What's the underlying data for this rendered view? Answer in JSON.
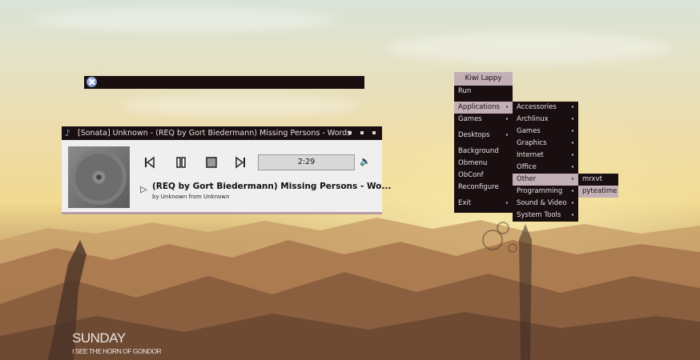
{
  "wallpaper": {
    "line1": "SUNDAY",
    "line2": "I SEE THE HORN OF GONDOR"
  },
  "topbar": {
    "logo_icon": "arch-x-logo-icon"
  },
  "sonata": {
    "window_title": "[Sonata] Unknown - (REQ by Gort Biedermann) Missing Persons - Words",
    "time": "2:29",
    "progress_fraction": 0.42,
    "song_title": "(REQ by Gort Biedermann) Missing Persons - Wo...",
    "byline": "by Unknown from Unknown",
    "icons": {
      "app": "music-note-icon",
      "prev": "skip-previous-icon",
      "pause": "pause-icon",
      "stop": "stop-icon",
      "next": "skip-next-icon",
      "volume": "volume-icon",
      "expander": "expander-triangle-icon"
    }
  },
  "root_menu": {
    "title": "Kiwi Lappy",
    "items": [
      {
        "label": "Run",
        "sub": false
      },
      {
        "label": "Applications",
        "sub": true,
        "active": true
      },
      {
        "label": "Games",
        "sub": true
      },
      {
        "label": "Desktops",
        "sub": true
      },
      {
        "label": "Background",
        "sub": false
      },
      {
        "label": "Obmenu",
        "sub": false
      },
      {
        "label": "ObConf",
        "sub": false
      },
      {
        "label": "Reconfigure",
        "sub": false
      },
      {
        "label": "Exit",
        "sub": true
      }
    ]
  },
  "apps_menu": {
    "items": [
      {
        "label": "Accessories",
        "sub": true
      },
      {
        "label": "Archlinux",
        "sub": true
      },
      {
        "label": "Games",
        "sub": true
      },
      {
        "label": "Graphics",
        "sub": true
      },
      {
        "label": "Internet",
        "sub": true
      },
      {
        "label": "Office",
        "sub": true
      },
      {
        "label": "Other",
        "sub": true,
        "active": true
      },
      {
        "label": "Programming",
        "sub": true
      },
      {
        "label": "Sound & Video",
        "sub": true
      },
      {
        "label": "System Tools",
        "sub": true
      }
    ]
  },
  "other_menu": {
    "items": [
      {
        "label": "mrxvt"
      },
      {
        "label": "pyteatime",
        "active": true
      }
    ]
  },
  "colors": {
    "menu_bg": "#1a0f10",
    "menu_highlight": "#c3b0b6",
    "menu_text": "#e8dfe3"
  }
}
